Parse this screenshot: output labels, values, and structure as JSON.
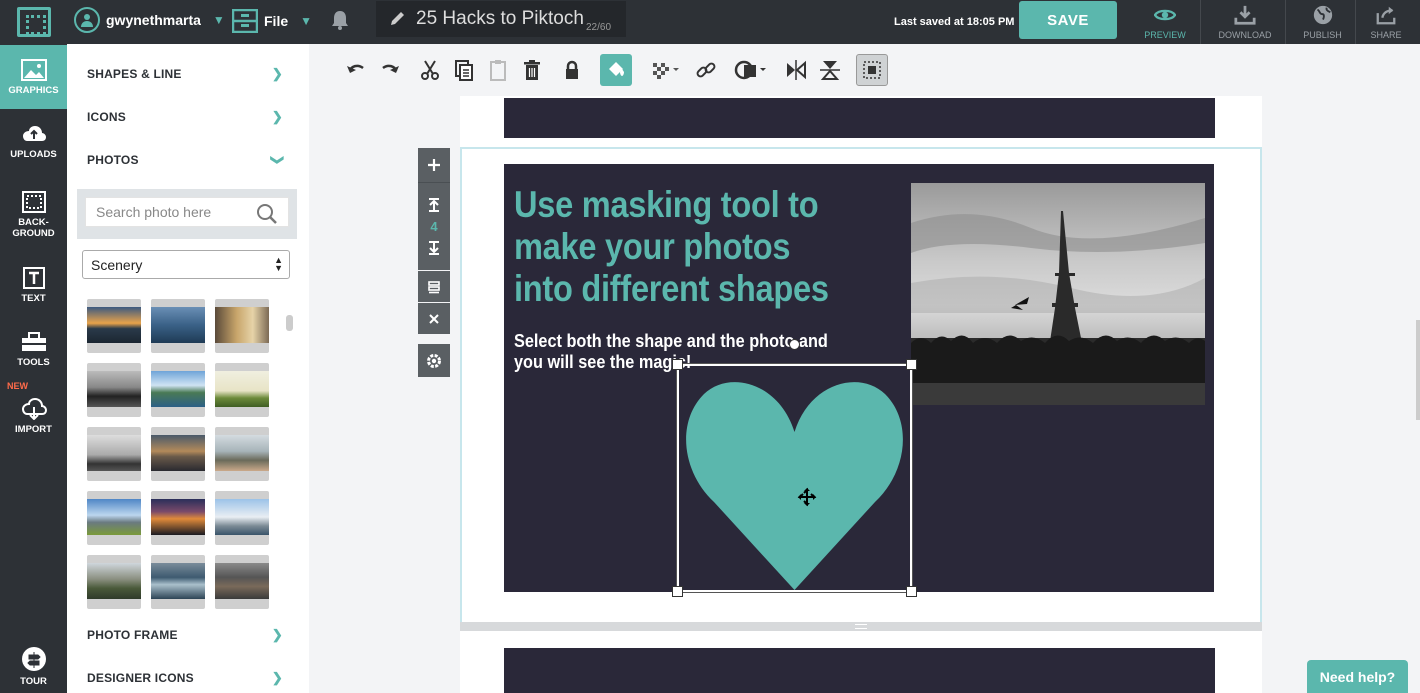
{
  "header": {
    "username": "gwynethmarta",
    "file_label": "File",
    "doc_title": "25 Hacks to Piktoch",
    "doc_counter": "22/60",
    "last_saved": "Last saved at 18:05 PM",
    "save_label": "SAVE",
    "actions": {
      "preview": "PREVIEW",
      "download": "DOWNLOAD",
      "publish": "PUBLISH",
      "share": "SHARE"
    }
  },
  "rail": {
    "graphics": "GRAPHICS",
    "uploads": "UPLOADS",
    "background_1": "BACK-",
    "background_2": "GROUND",
    "text": "TEXT",
    "tools": "TOOLS",
    "new_badge": "NEW",
    "import": "IMPORT",
    "tour": "TOUR"
  },
  "panel": {
    "shapes_line": "SHAPES & LINE",
    "icons": "ICONS",
    "photos": "PHOTOS",
    "search_placeholder": "Search photo here",
    "category_selected": "Scenery",
    "photo_frame": "PHOTO FRAME",
    "designer_icons": "DESIGNER ICONS"
  },
  "canvas": {
    "page_number": "4",
    "heading": "Use masking tool to make your photos into different shapes",
    "subtext": "Select both the shape and the photo and you will see the magic!"
  },
  "help": {
    "label": "Need help?"
  },
  "colors": {
    "accent": "#5bb7ad",
    "dark_bar": "#2d3136",
    "slide_bg": "#2a2839"
  }
}
